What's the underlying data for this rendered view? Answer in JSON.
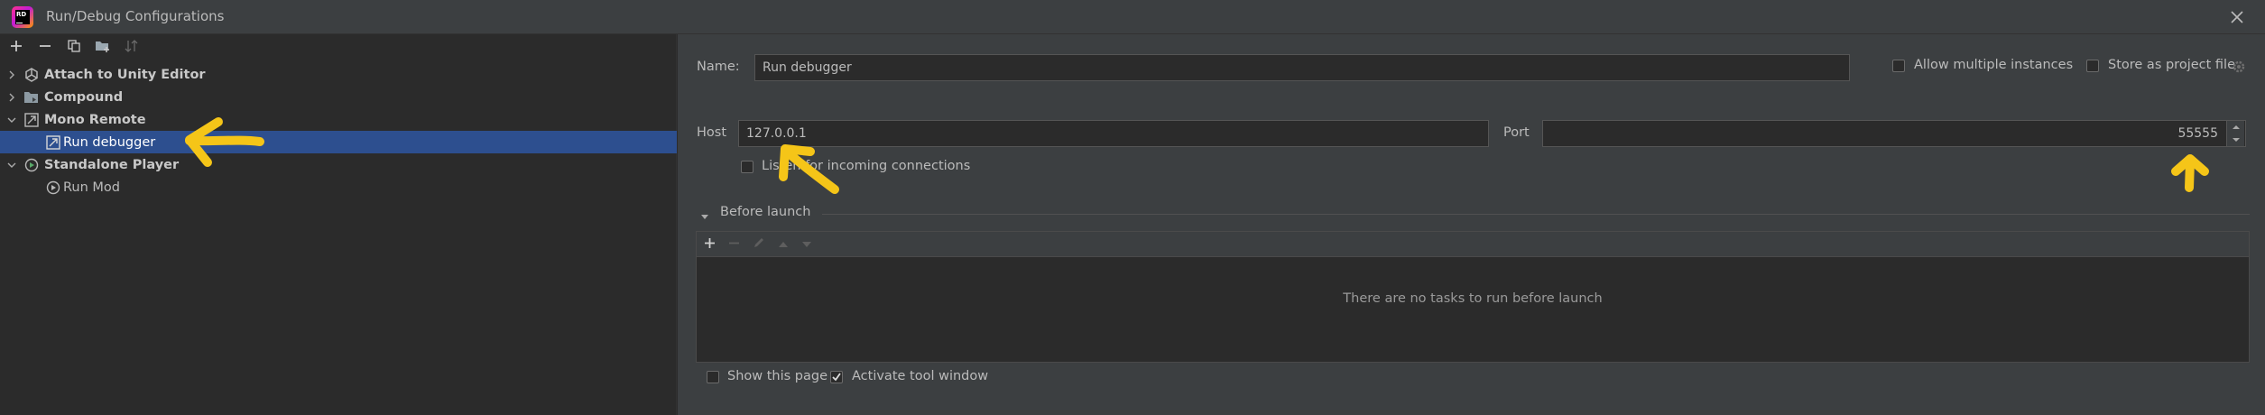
{
  "window": {
    "title": "Run/Debug Configurations",
    "logo_text": "RD"
  },
  "tree": {
    "items": [
      {
        "label": "Attach to Unity Editor"
      },
      {
        "label": "Compound"
      },
      {
        "label": "Mono Remote"
      },
      {
        "label": "Run debugger"
      },
      {
        "label": "Standalone Player"
      },
      {
        "label": "Run Mod"
      }
    ]
  },
  "form": {
    "name_label": "Name:",
    "name_value": "Run debugger",
    "allow_multiple_label": "Allow multiple instances",
    "store_as_project_label": "Store as project file",
    "host_label": "Host",
    "host_value": "127.0.0.1",
    "port_label": "Port",
    "port_value": "55555",
    "listen_label": "Listen for incoming connections"
  },
  "before_launch": {
    "title": "Before launch",
    "empty_text": "There are no tasks to run before launch"
  },
  "footer": {
    "show_page_label": "Show this page",
    "activate_tool_label": "Activate tool window",
    "activate_tool_checked": true
  },
  "colors": {
    "annotation": "#f5c518",
    "selection": "#2d4f8f"
  }
}
